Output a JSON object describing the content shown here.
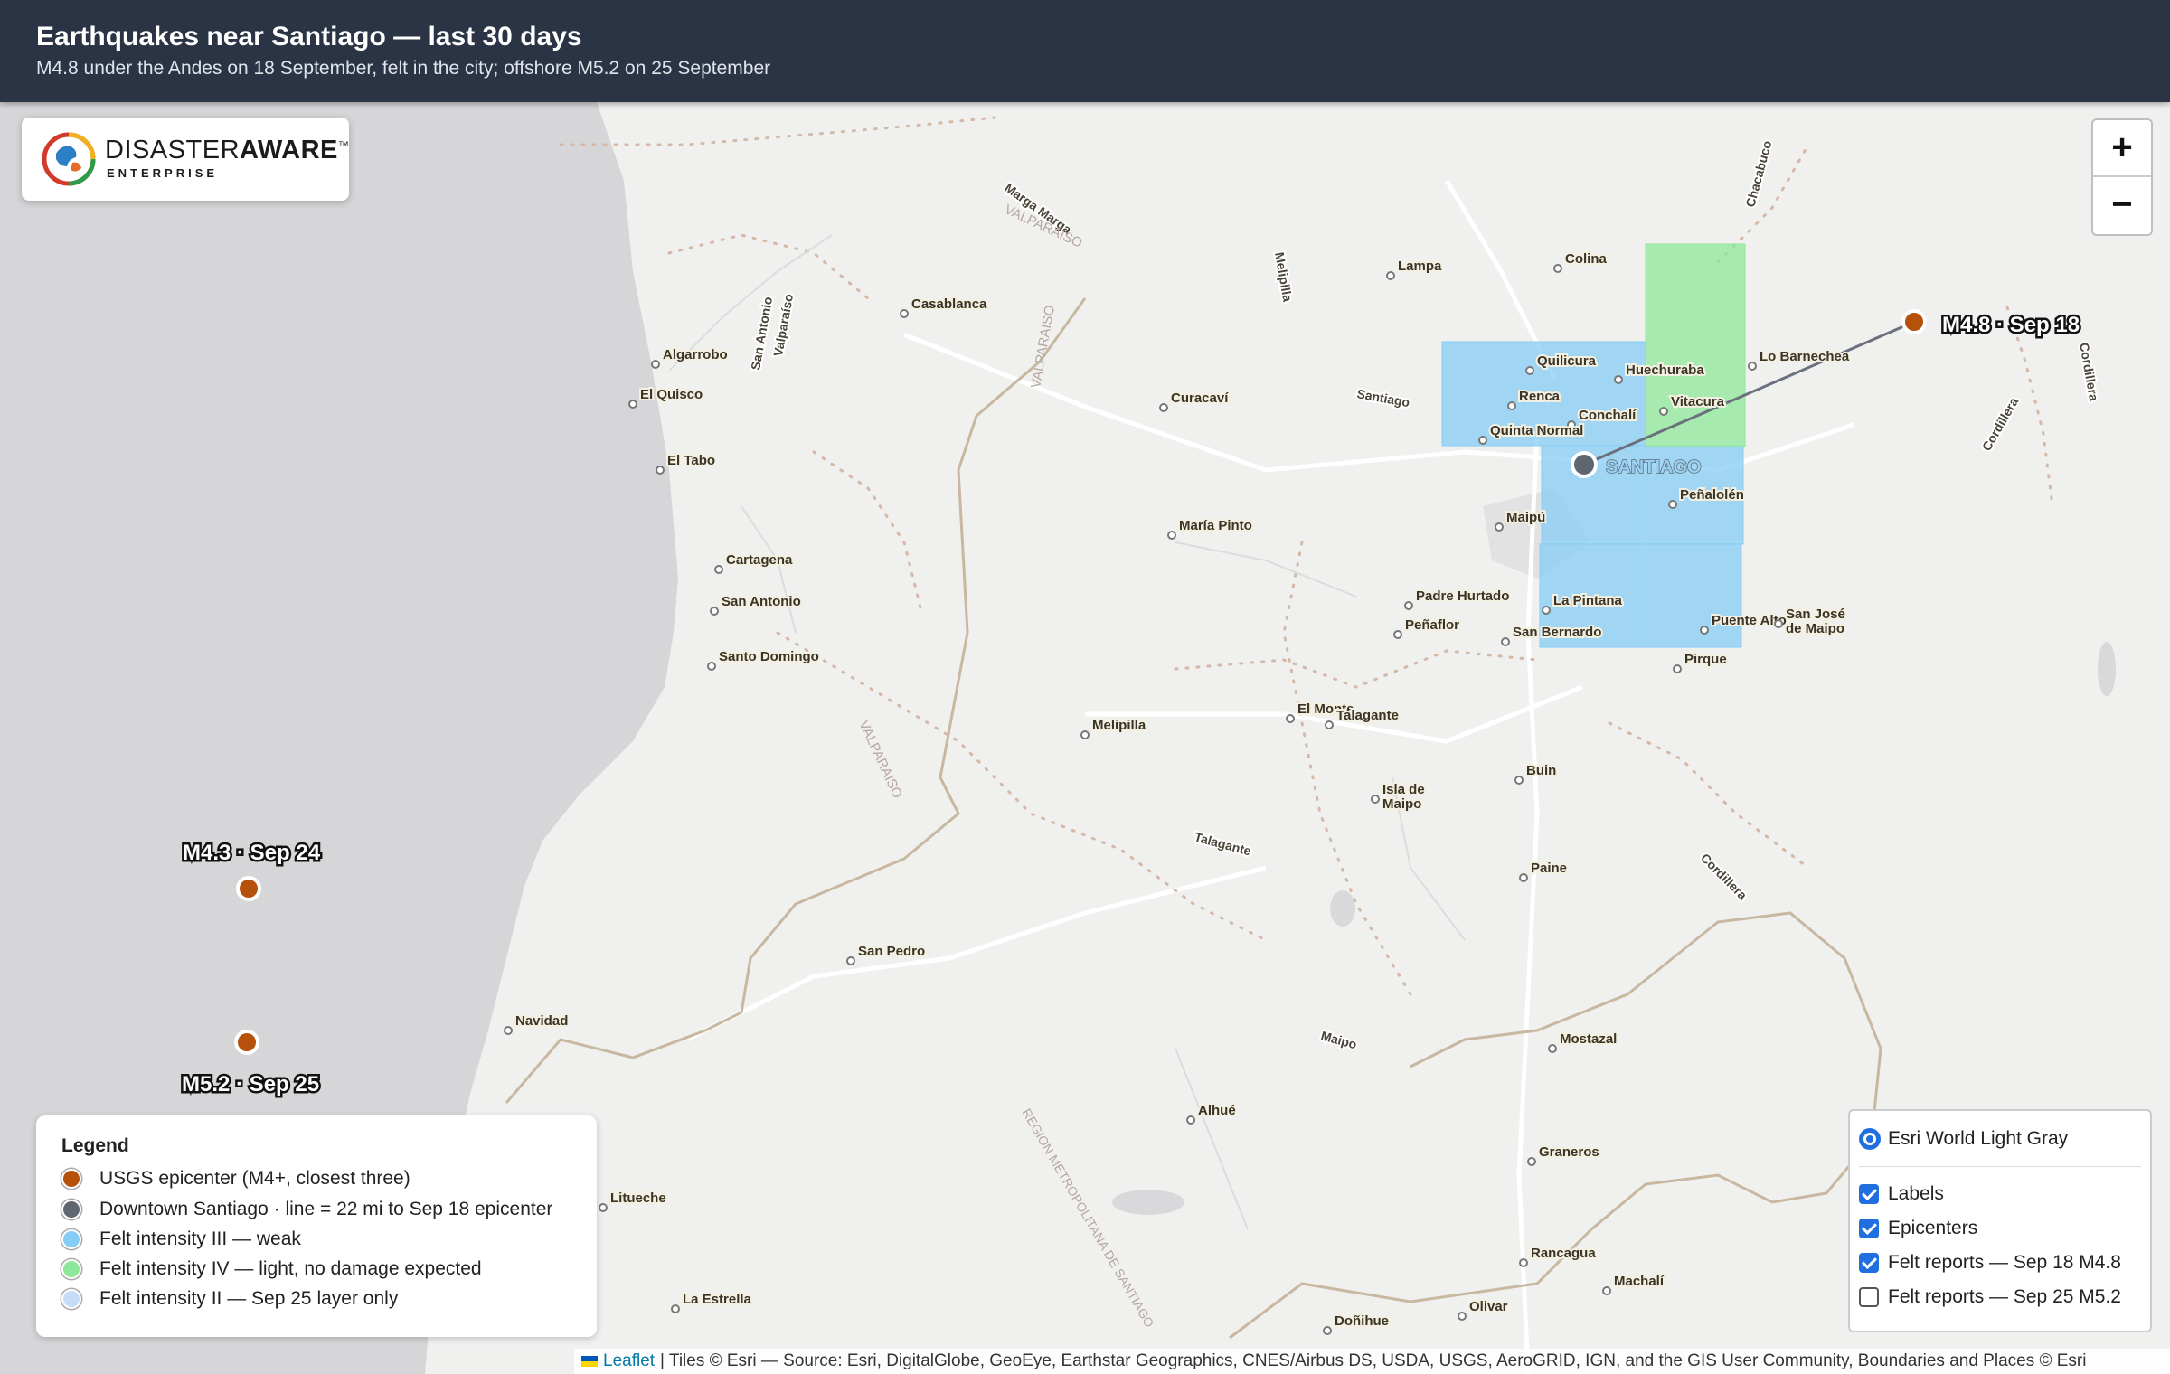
{
  "header": {
    "title": "Earthquakes near Santiago — last 30 days",
    "subtitle": "M4.8 under the Andes on 18 September, felt in the city; offshore M5.2 on 25 September"
  },
  "logo": {
    "name_light": "DISASTER",
    "name_bold": "AWARE",
    "trademark": "™",
    "tagline": "ENTERPRISE"
  },
  "zoom": {
    "in_label": "+",
    "out_label": "−"
  },
  "colors": {
    "epicenter": "#b5510b",
    "downtown": "#5f6670",
    "intensity_iii": "#86cdf5",
    "intensity_iv": "#8ee89a",
    "intensity_ii": "#c6dcf7",
    "ocean": "#d6d6d8",
    "land": "#f0f0ef"
  },
  "map": {
    "epicenters": [
      {
        "label": "M4.8 · Sep 18"
      },
      {
        "label": "M4.3 · Sep 24"
      },
      {
        "label": "M5.2 · Sep 25"
      }
    ],
    "downtown_label": "SANTIAGO",
    "places": [
      "Colina",
      "Lampa",
      "Quilicura",
      "Huechuraba",
      "Lo Barnechea",
      "Renca",
      "Conchalí",
      "Vitacura",
      "Quinta Normal",
      "Peñalolén",
      "Maipú",
      "Padre Hurtado",
      "Peñaflor",
      "La Pintana",
      "San Bernardo",
      "Puente Alto",
      "San José de Maipo",
      "Pirque",
      "Casablanca",
      "Algarrobo",
      "El Quisco",
      "El Tabo",
      "Cartagena",
      "San Antonio",
      "Santo Domingo",
      "Curacaví",
      "María Pinto",
      "Melipilla",
      "El Monte",
      "Talagante",
      "Buin",
      "Isla de Maipo",
      "Paine",
      "San Pedro",
      "Navidad",
      "Litueche",
      "La Estrella",
      "Alhué",
      "Mostazal",
      "Graneros",
      "Rancagua",
      "Machalí",
      "Olivar",
      "Doñihue"
    ],
    "region_labels": [
      "VALPARAISO",
      "VALPARAISO",
      "VALPARAISO",
      "REGION METROPOLITANA DE SANTIAGO"
    ],
    "road_labels": [
      "Cordillera",
      "Cordillera",
      "Cordillera",
      "Chacabuco",
      "Melipilla",
      "Talagante",
      "Maipo",
      "Marga Marga",
      "San Antonio",
      "Valparaíso",
      "Santiago"
    ]
  },
  "legend": {
    "title": "Legend",
    "items": [
      {
        "label": "USGS epicenter (M4+, closest three)",
        "color": "#b5510b"
      },
      {
        "label": "Downtown Santiago · line = 22 mi to Sep 18 epicenter",
        "color": "#5f6670"
      },
      {
        "label": "Felt intensity III — weak",
        "color": "#86cdf5"
      },
      {
        "label": "Felt intensity IV — light, no damage expected",
        "color": "#8ee89a"
      },
      {
        "label": "Felt intensity II — Sep 25 layer only",
        "color": "#c6dcf7"
      }
    ]
  },
  "layers": {
    "base": "Esri World Light Gray",
    "overlays": [
      {
        "label": "Labels",
        "checked": true
      },
      {
        "label": "Epicenters",
        "checked": true
      },
      {
        "label": "Felt reports — Sep 18 M4.8",
        "checked": true
      },
      {
        "label": "Felt reports — Sep 25 M5.2",
        "checked": false
      }
    ]
  },
  "attribution": {
    "leaflet": "Leaflet",
    "text": "| Tiles © Esri — Source: Esri, DigitalGlobe, GeoEye, Earthstar Geographics, CNES/Airbus DS, USDA, USGS, AeroGRID, IGN, and the GIS User Community, Boundaries and Places © Esri"
  }
}
